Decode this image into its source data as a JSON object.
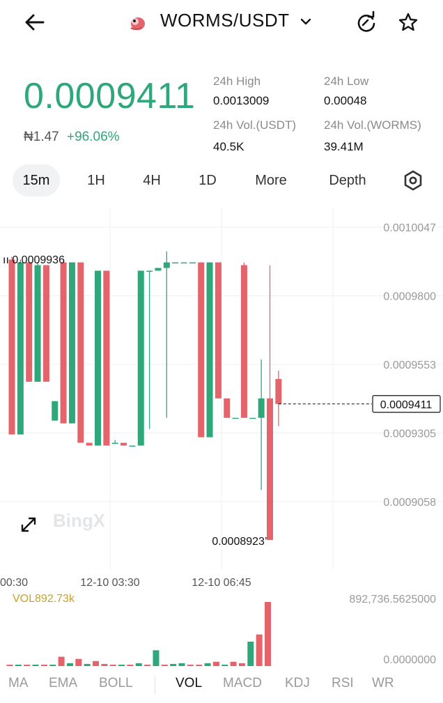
{
  "header": {
    "pair": "WORMS/USDT",
    "icons": {
      "back": "arrow-left-icon",
      "logo": "worms-coin-logo",
      "dropdown": "chevron-down-icon",
      "refresh": "refresh-icon",
      "favorite": "star-icon"
    }
  },
  "ticker": {
    "last_price": "0.0009411",
    "fiat_value": "₦1.47",
    "change_pct": "+96.06%",
    "stats": [
      {
        "label": "24h High",
        "value": "0.0013009"
      },
      {
        "label": "24h Low",
        "value": "0.00048"
      },
      {
        "label": "24h Vol.(USDT)",
        "value": "40.5K"
      },
      {
        "label": "24h Vol.(WORMS)",
        "value": "39.41M"
      }
    ],
    "colors": {
      "up": "#2ea77a",
      "down": "#e5636b"
    }
  },
  "timeframes": {
    "tabs": [
      "15m",
      "1H",
      "4H",
      "1D",
      "More",
      "Depth"
    ],
    "active": "15m",
    "settings_icon": "settings-hexagon-icon"
  },
  "chart": {
    "watermark": "BingX",
    "max_label": "0.0009936",
    "min_label": "0.0008923",
    "current_price_label": "0.0009411",
    "expand_icon": "expand-arrows-icon",
    "vol_label": "VOL892.73k",
    "vol_axis": [
      "892,736.5625000",
      "0.0000000"
    ]
  },
  "chart_data": {
    "type": "candlestick",
    "y_ticks": [
      "0.0010047",
      "0.0009800",
      "0.0009553",
      "0.0009305",
      "0.0009058"
    ],
    "x_ticks": [
      "00:30",
      "12-10 03:30",
      "12-10 06:45"
    ],
    "candles": [
      {
        "o": 0.000993,
        "h": 0.000994,
        "l": 0.00093,
        "c": 0.00093
      },
      {
        "o": 0.00093,
        "h": 0.000993,
        "l": 0.00093,
        "c": 0.000992
      },
      {
        "o": 0.000992,
        "h": 0.000992,
        "l": 0.000949,
        "c": 0.000949
      },
      {
        "o": 0.000949,
        "h": 0.000992,
        "l": 0.000949,
        "c": 0.000991
      },
      {
        "o": 0.000991,
        "h": 0.000991,
        "l": 0.000949,
        "c": 0.000949
      },
      {
        "o": 0.000935,
        "h": 0.000942,
        "l": 0.000935,
        "c": 0.000942
      },
      {
        "o": 0.000992,
        "h": 0.000993,
        "l": 0.000934,
        "c": 0.000934
      },
      {
        "o": 0.000934,
        "h": 0.000992,
        "l": 0.000934,
        "c": 0.000992
      },
      {
        "o": 0.000992,
        "h": 0.000992,
        "l": 0.000927,
        "c": 0.000927
      },
      {
        "o": 0.000927,
        "h": 0.000927,
        "l": 0.000926,
        "c": 0.000926
      },
      {
        "o": 0.000926,
        "h": 0.000989,
        "l": 0.000926,
        "c": 0.000989
      },
      {
        "o": 0.000989,
        "h": 0.000989,
        "l": 0.000926,
        "c": 0.000926
      },
      {
        "o": 0.000927,
        "h": 0.000928,
        "l": 0.000927,
        "c": 0.000927
      },
      {
        "o": 0.000927,
        "h": 0.000927,
        "l": 0.000926,
        "c": 0.000926
      },
      {
        "o": 0.000926,
        "h": 0.000926,
        "l": 0.000926,
        "c": 0.000926
      },
      {
        "o": 0.000926,
        "h": 0.000989,
        "l": 0.000926,
        "c": 0.000989
      },
      {
        "o": 0.000989,
        "h": 0.000989,
        "l": 0.000932,
        "c": 0.000989
      },
      {
        "o": 0.000989,
        "h": 0.00099,
        "l": 0.00099,
        "c": 0.00099
      },
      {
        "o": 0.00099,
        "h": 0.000996,
        "l": 0.000936,
        "c": 0.000992
      },
      {
        "o": 0.000992,
        "h": 0.000992,
        "l": 0.000992,
        "c": 0.000992
      },
      {
        "o": 0.000992,
        "h": 0.000992,
        "l": 0.000992,
        "c": 0.000992
      },
      {
        "o": 0.000992,
        "h": 0.000992,
        "l": 0.000992,
        "c": 0.000992
      },
      {
        "o": 0.000992,
        "h": 0.000992,
        "l": 0.000929,
        "c": 0.000929
      },
      {
        "o": 0.000929,
        "h": 0.000992,
        "l": 0.000929,
        "c": 0.000992
      },
      {
        "o": 0.000992,
        "h": 0.000992,
        "l": 0.000943,
        "c": 0.000943
      },
      {
        "o": 0.000943,
        "h": 0.000943,
        "l": 0.000936,
        "c": 0.000936
      },
      {
        "o": 0.000936,
        "h": 0.000936,
        "l": 0.000936,
        "c": 0.000936
      },
      {
        "o": 0.000991,
        "h": 0.000992,
        "l": 0.000936,
        "c": 0.000936
      },
      {
        "o": 0.000936,
        "h": 0.000936,
        "l": 0.000936,
        "c": 0.000936
      },
      {
        "o": 0.000936,
        "h": 0.000957,
        "l": 0.00091,
        "c": 0.000943
      },
      {
        "o": 0.000943,
        "h": 0.000991,
        "l": 0.000892,
        "c": 0.000892
      },
      {
        "o": 0.00095,
        "h": 0.000953,
        "l": 0.000933,
        "c": 0.000941
      }
    ],
    "volume": [
      {
        "v": 10000,
        "dir": "down"
      },
      {
        "v": 5000,
        "dir": "up"
      },
      {
        "v": 8000,
        "dir": "down"
      },
      {
        "v": 6000,
        "dir": "up"
      },
      {
        "v": 6000,
        "dir": "down"
      },
      {
        "v": 4000,
        "dir": "up"
      },
      {
        "v": 130000,
        "dir": "down"
      },
      {
        "v": 40000,
        "dir": "up"
      },
      {
        "v": 100000,
        "dir": "down"
      },
      {
        "v": 30000,
        "dir": "up"
      },
      {
        "v": 70000,
        "dir": "down"
      },
      {
        "v": 30000,
        "dir": "down"
      },
      {
        "v": 8000,
        "dir": "down"
      },
      {
        "v": 6000,
        "dir": "up"
      },
      {
        "v": 10000,
        "dir": "down"
      },
      {
        "v": 40000,
        "dir": "up"
      },
      {
        "v": 20000,
        "dir": "down"
      },
      {
        "v": 220000,
        "dir": "up"
      },
      {
        "v": 6000,
        "dir": "down"
      },
      {
        "v": 30000,
        "dir": "up"
      },
      {
        "v": 40000,
        "dir": "up"
      },
      {
        "v": 20000,
        "dir": "down"
      },
      {
        "v": 6000,
        "dir": "down"
      },
      {
        "v": 40000,
        "dir": "up"
      },
      {
        "v": 60000,
        "dir": "down"
      },
      {
        "v": 20000,
        "dir": "up"
      },
      {
        "v": 60000,
        "dir": "down"
      },
      {
        "v": 40000,
        "dir": "down"
      },
      {
        "v": 340000,
        "dir": "up"
      },
      {
        "v": 440000,
        "dir": "down"
      },
      {
        "v": 892736,
        "dir": "down"
      }
    ]
  },
  "indicators": {
    "tabs": [
      "MA",
      "EMA",
      "BOLL",
      "VOL",
      "MACD",
      "KDJ",
      "RSI",
      "WR"
    ],
    "active": "VOL"
  }
}
